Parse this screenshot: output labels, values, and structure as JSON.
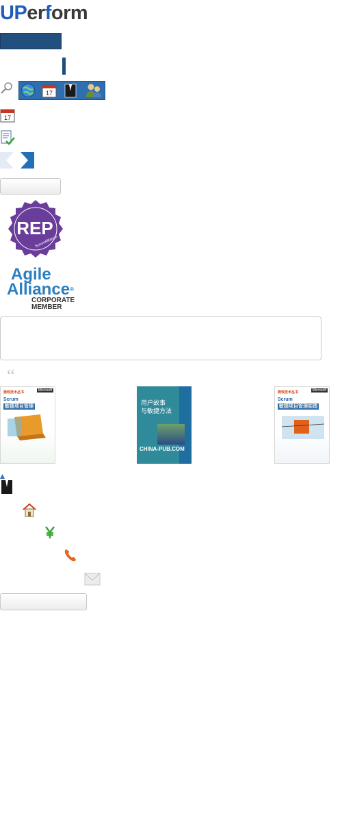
{
  "brand": {
    "logo_part1": "UP",
    "logo_part2": "er",
    "logo_part3": "f",
    "logo_part4": "orm"
  },
  "toolbar": {
    "icons": [
      "globe-icon",
      "calendar-icon",
      "tuxedo-icon",
      "users-icon"
    ],
    "calendar_day": "17"
  },
  "sidebar": {
    "calendar_day": "17"
  },
  "badges": {
    "rep_text": "REP",
    "rep_sub": "ScrumAlliance",
    "agile_line1": "Agile",
    "agile_line2": "Alliance",
    "agile_line3": "CORPORATE",
    "agile_line4": "MEMBER",
    "agile_reg": "®"
  },
  "quote_mark": "“",
  "books": [
    {
      "series": "微软技术丛书",
      "publisher_tag": "Microsoft",
      "title": "Scrum",
      "subtitle": "敏捷项目管理"
    },
    {
      "title_line1": "用户故事",
      "title_line2": "与敏捷方法",
      "footer": "CHINA-PUB.COM"
    },
    {
      "series": "微软技术丛书",
      "publisher_tag": "Microsoft",
      "title": "Scrum",
      "subtitle": "敏捷项目管理实践"
    }
  ],
  "contact_icons": [
    "home-icon",
    "yen-icon",
    "phone-icon",
    "mail-icon"
  ],
  "colors": {
    "brand_blue": "#1f5fb8",
    "navy": "#214f7e",
    "rep_purple": "#6a3d9a",
    "agile_blue": "#2a7fc0"
  }
}
